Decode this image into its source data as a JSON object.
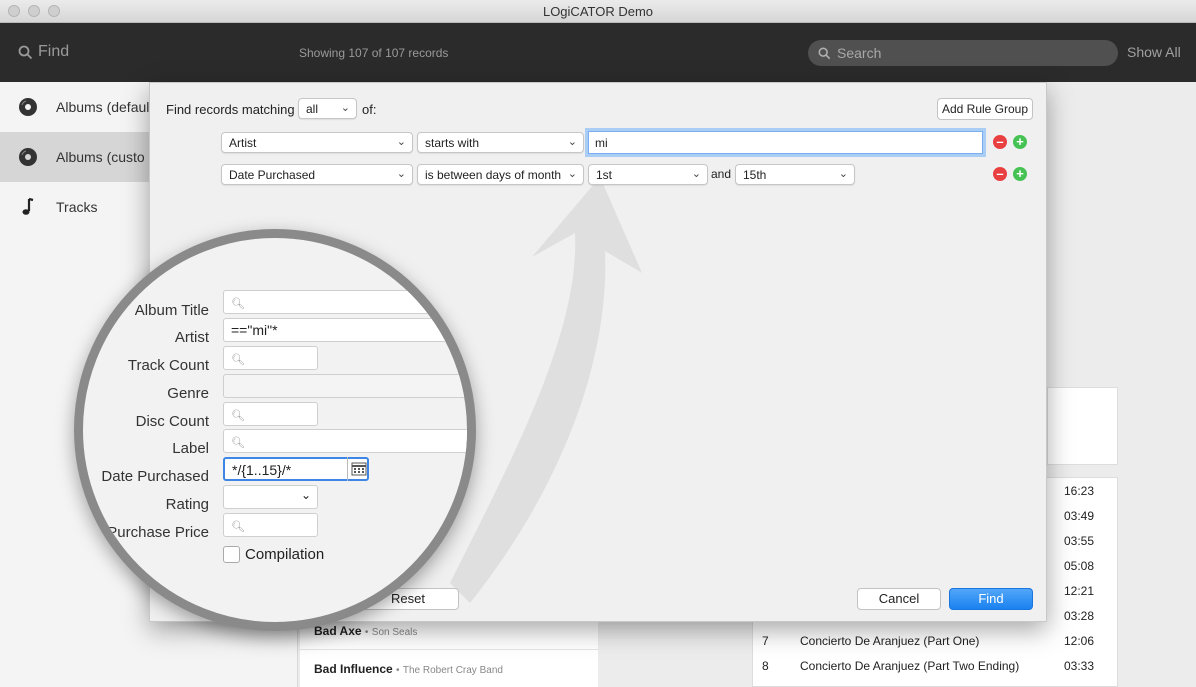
{
  "window": {
    "title": "LOgiCATOR Demo"
  },
  "toolbar": {
    "find_label": "Find",
    "showing": "Showing 107 of 107 records",
    "search_placeholder": "Search",
    "show_all": "Show All"
  },
  "sidebar": {
    "items": [
      {
        "label": "Albums (defaul",
        "icon": "vinyl-record-icon"
      },
      {
        "label": "Albums (custo",
        "icon": "vinyl-record-icon"
      },
      {
        "label": "Tracks",
        "icon": "music-note-icon"
      }
    ]
  },
  "albums": [
    {
      "title": "Bad Axe",
      "artist": "Son Seals"
    },
    {
      "title": "Bad Influence",
      "artist": "The Robert Cray Band"
    }
  ],
  "tracks": {
    "durations_top": [
      "16:23",
      "03:49",
      "03:55",
      "05:08",
      "12:21",
      "03:28"
    ],
    "rows": [
      {
        "num": "7",
        "name": "Concierto De Aranjuez (Part One)",
        "duration": "12:06"
      },
      {
        "num": "8",
        "name": "Concierto De Aranjuez (Part Two Ending)",
        "duration": "03:33"
      }
    ]
  },
  "dialog": {
    "find_matching": "Find records matching",
    "match_mode": "all",
    "of": "of:",
    "add_rule_group": "Add Rule Group",
    "rules": [
      {
        "field": "Artist",
        "operator": "starts with",
        "value": "mi"
      },
      {
        "field": "Date Purchased",
        "operator": "is between days of month",
        "from": "1st",
        "and": "and",
        "to": "15th"
      }
    ],
    "reset": "Reset",
    "cancel": "Cancel",
    "find": "Find"
  },
  "magnifier": {
    "fields": [
      {
        "label": "Album Title",
        "value": ""
      },
      {
        "label": "Artist",
        "value": "==\"mi\"*"
      },
      {
        "label": "Track Count",
        "value": ""
      },
      {
        "label": "Genre",
        "value": ""
      },
      {
        "label": "Disc Count",
        "value": ""
      },
      {
        "label": "Label",
        "value": ""
      },
      {
        "label": "Date Purchased",
        "value": "*/{1..15}/*"
      },
      {
        "label": "Rating",
        "value": ""
      },
      {
        "label": "Purchase Price",
        "value": ""
      }
    ],
    "compilation": "Compilation"
  }
}
